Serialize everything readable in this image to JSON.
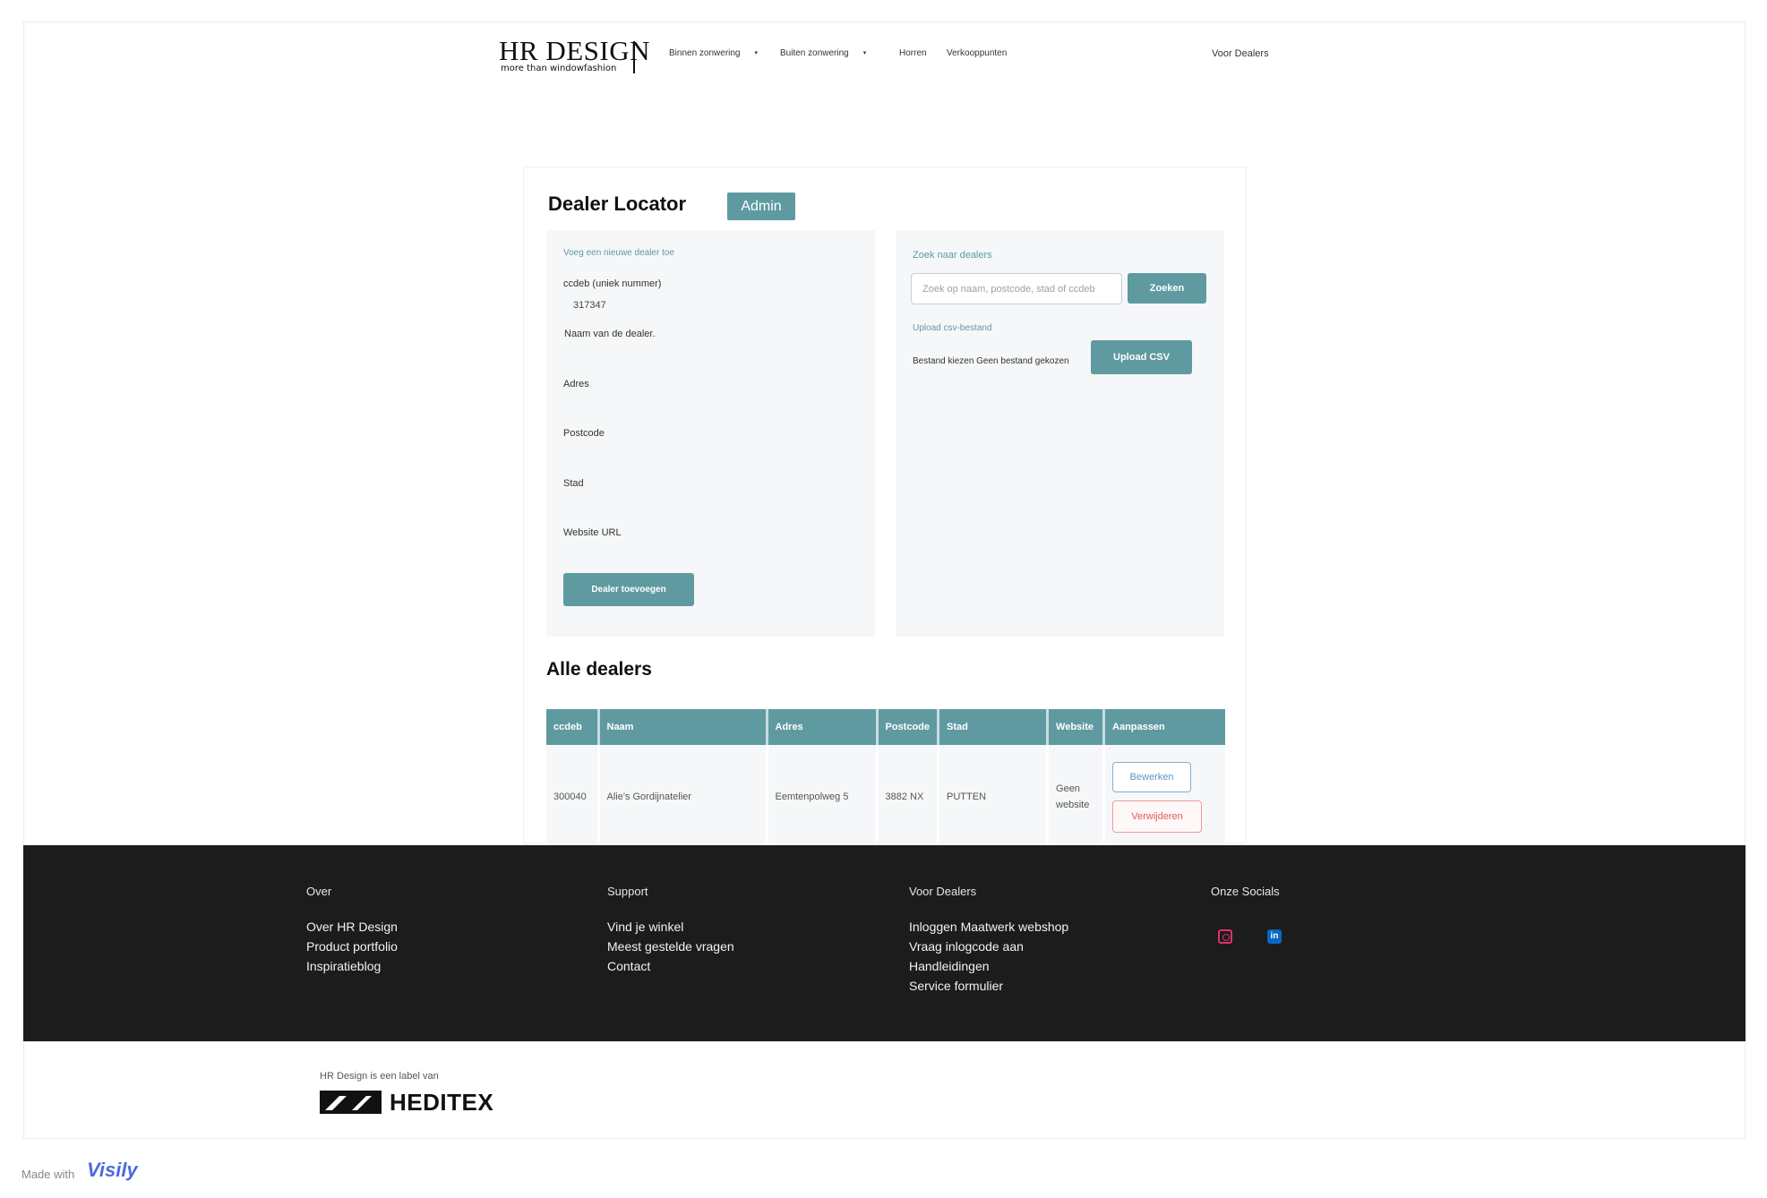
{
  "header": {
    "logo_main": "HR DESIGN",
    "logo_sub": "more than windowfashion",
    "nav": [
      {
        "label": "Binnen zonwering",
        "caret": "▾"
      },
      {
        "label": "Buiten zonwering",
        "caret": "▾"
      },
      {
        "label": "Horren"
      },
      {
        "label": "Verkooppunten"
      }
    ],
    "dealers_link": "Voor Dealers"
  },
  "card": {
    "title": "Dealer Locator",
    "admin_label": "Admin"
  },
  "add_form": {
    "heading": "Voeg een nieuwe dealer toe",
    "ccdeb_label": "ccdeb (uniek nummer)",
    "ccdeb_value": "317347",
    "name_label": "Naam van de dealer.",
    "address_label": "Adres",
    "postcode_label": "Postcode",
    "city_label": "Stad",
    "website_label": "Website URL",
    "submit_label": "Dealer toevoegen"
  },
  "search": {
    "heading": "Zoek naar dealers",
    "placeholder": "Zoek op naam, postcode, stad of ccdeb",
    "button_label": "Zoeken",
    "upload_heading": "Upload csv-bestand",
    "file_text": "Bestand kiezen Geen bestand gekozen",
    "upload_label": "Upload CSV"
  },
  "dealers": {
    "title": "Alle dealers",
    "columns": [
      "ccdeb",
      "Naam",
      "Adres",
      "Postcode",
      "Stad",
      "Website",
      "Aanpassen"
    ],
    "rows": [
      {
        "ccdeb": "300040",
        "naam": "Alie's Gordijnatelier",
        "adres": "Eemtenpolweg 5",
        "postcode": "3882 NX",
        "stad": "PUTTEN",
        "website": "Geen website",
        "edit_label": "Bewerken",
        "delete_label": "Verwijderen"
      }
    ]
  },
  "footer": {
    "columns": [
      {
        "heading": "Over",
        "links": [
          "Over HR Design",
          "Product portfolio",
          "Inspiratieblog"
        ]
      },
      {
        "heading": "Support",
        "links": [
          "Vind je winkel",
          "Meest gestelde vragen",
          "Contact"
        ]
      },
      {
        "heading": "Voor Dealers",
        "links": [
          "Inloggen Maatwerk webshop",
          "Vraag inlogcode aan",
          "Handleidingen",
          "Service formulier"
        ]
      },
      {
        "heading": "Onze Socials",
        "links": []
      }
    ],
    "socials": [
      {
        "icon": "instagram-icon",
        "color": "#e1306c"
      },
      {
        "icon": "linkedin-icon",
        "color": "#0a66c2"
      }
    ]
  },
  "bottom": {
    "label_text": "HR Design is een label van",
    "brand": "HEDITEX"
  },
  "watermark": {
    "made_with": "Made with",
    "brand": "Visily"
  },
  "colors": {
    "accent": "#5f9aa1",
    "panel_bg": "#f5f7f9",
    "footer_bg": "#1c1c1c",
    "edit": "#5b94c8",
    "delete": "#e05a5a"
  }
}
